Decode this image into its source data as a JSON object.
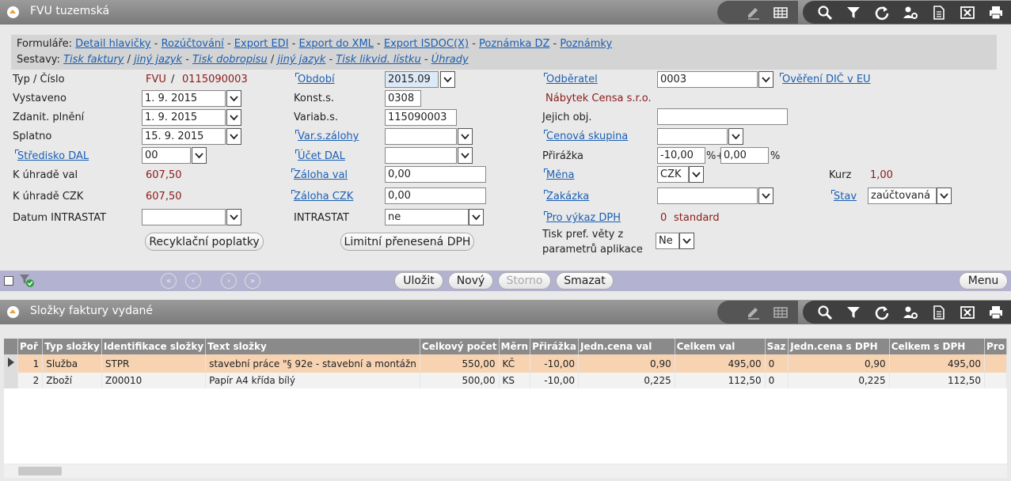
{
  "main_panel": {
    "title": "FVU tuzemská"
  },
  "items_panel": {
    "title": "Složky faktury vydané"
  },
  "links": {
    "formulare_label": "Formuláře:",
    "formulare": [
      "Detail hlavičky",
      "Rozúčtování",
      "Export EDI",
      "Export do XML",
      "Export ISDOC(X)",
      "Poznámka DZ",
      "Poznámky"
    ],
    "sestavy_label": "Sestavy:",
    "sestavy": [
      "Tisk faktury",
      "jiný jazyk",
      "Tisk dobropisu",
      "jiný jazyk",
      "Tisk likvid. lístku",
      "Úhrady"
    ]
  },
  "form": {
    "typ_cislo_label": "Typ / Číslo",
    "typ": "FVU",
    "slash": "/",
    "cislo": "0115090003",
    "vystaveno_label": "Vystaveno",
    "vystaveno": "1. 9. 2015",
    "zdanit_label": "Zdanit. plnění",
    "zdanit": "1. 9. 2015",
    "splatno_label": "Splatno",
    "splatno": "15. 9. 2015",
    "stredisko_label": "Středisko DAL",
    "stredisko": "00",
    "k_uhrade_val_label": "K úhradě val",
    "k_uhrade_val": "607,50",
    "k_uhrade_czk_label": "K úhradě CZK",
    "k_uhrade_czk": "607,50",
    "datum_intrastat_label": "Datum INTRASTAT",
    "datum_intrastat": "",
    "obdobi_label": "Období",
    "obdobi": "2015.09",
    "konst_label": "Konst.s.",
    "konst": "0308",
    "variab_label": "Variab.s.",
    "variab": "115090003",
    "var_zalohy_label": "Var.s.zálohy",
    "var_zalohy": "",
    "ucet_dal_label": "Účet DAL",
    "ucet_dal": "",
    "zaloha_val_label": "Záloha val",
    "zaloha_val": "0,00",
    "zaloha_czk_label": "Záloha CZK",
    "zaloha_czk": "0,00",
    "intrastat_label": "INTRASTAT",
    "intrastat": "ne",
    "odberatel_label": "Odběratel",
    "odberatel": "0003",
    "overeni_label": "Ověření DIČ v EU",
    "odberatel_name": "Nábytek Censa s.r.o.",
    "jejich_obj_label": "Jejich obj.",
    "jejich_obj": "",
    "cenova_label": "Cenová skupina",
    "cenova": "",
    "prirazka_label": "Přirážka",
    "prirazka1": "-10,00",
    "prirazka_mid": "%+",
    "prirazka2": "0,00",
    "prirazka_end": "%",
    "mena_label": "Měna",
    "mena": "CZK",
    "kurz_label": "Kurz",
    "kurz": "1,00",
    "zakazka_label": "Zakázka",
    "zakazka": "",
    "stav_label": "Stav",
    "stav": "zaúčtovaná",
    "pro_vykaz_label": "Pro výkaz DPH",
    "pro_vykaz_code": "0",
    "pro_vykaz_text": "standard",
    "tisk_pref_label1": "Tisk pref. věty z",
    "tisk_pref_label2": "parametrů aplikace",
    "tisk_pref": "Ne",
    "btn_recyklacni": "Recyklační poplatky",
    "btn_limitni": "Limitní přenesená DPH"
  },
  "actions": {
    "ulozit": "Uložit",
    "novy": "Nový",
    "storno": "Storno",
    "smazat": "Smazat",
    "menu": "Menu"
  },
  "table": {
    "headers": [
      "Poř",
      "Typ složky",
      "Identifikace složky",
      "Text složky",
      "Celkový počet",
      "Měrn",
      "Přirážka",
      "Jedn.cena val",
      "Celkem val",
      "Saz",
      "Jedn.cena s DPH",
      "Celkem s DPH",
      "Pro"
    ],
    "rows": [
      [
        "1",
        "Služba",
        "STPR",
        "stavební práce \"§ 92e - stavební a montážn",
        "550,00",
        "KČ",
        "-10,00",
        "0,90",
        "495,00",
        "0",
        "0,90",
        "495,00",
        ""
      ],
      [
        "2",
        "Zboží",
        "Z00010",
        "Papír A4 křída bílý",
        "500,00",
        "KS",
        "-10,00",
        "0,225",
        "112,50",
        "0",
        "0,225",
        "112,50",
        ""
      ]
    ]
  },
  "colors": {
    "link": "#1a5fb4",
    "value": "#8b1a1a",
    "selected_row": "#f7d3b2",
    "navbar": "#b3b3d1",
    "header_bg": "#8a8a8a"
  }
}
